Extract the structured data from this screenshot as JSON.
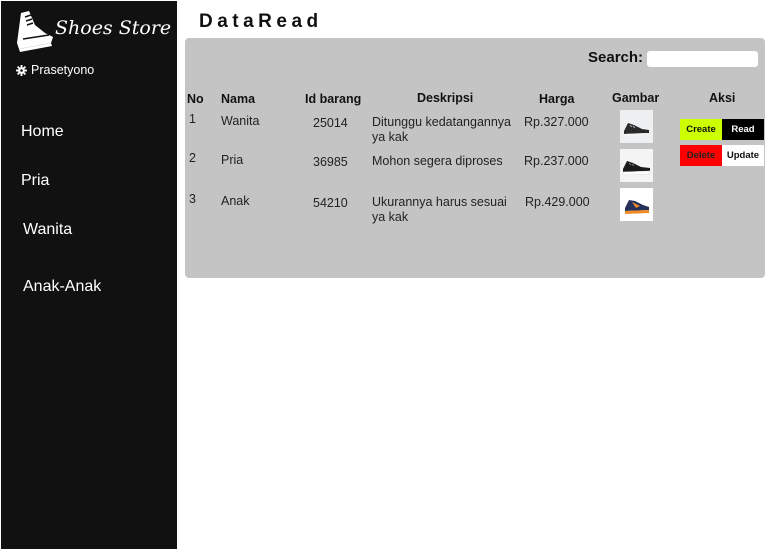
{
  "brand": {
    "name": "Shoes Store",
    "logo_icon": "shoe-icon"
  },
  "user": {
    "name": "Prasetyono",
    "icon": "gear-icon"
  },
  "nav": {
    "home": "Home",
    "pria": "Pria",
    "wanita": "Wanita",
    "anak": "Anak-Anak"
  },
  "page": {
    "title": "DataRead"
  },
  "search": {
    "label": "Search:",
    "value": ""
  },
  "table": {
    "headers": {
      "no": "No",
      "nama": "Nama",
      "id": "Id barang",
      "deskripsi": "Deskripsi",
      "harga": "Harga",
      "gambar": "Gambar",
      "aksi": "Aksi"
    },
    "rows": [
      {
        "no": "1",
        "nama": "Wanita",
        "id": "25014",
        "deskripsi": "Ditunggu kedatangannya ya kak",
        "harga": "Rp.327.000"
      },
      {
        "no": "2",
        "nama": "Pria",
        "id": "36985",
        "deskripsi": "Mohon segera diproses",
        "harga": "Rp.237.000"
      },
      {
        "no": "3",
        "nama": "Anak",
        "id": "54210",
        "deskripsi": "Ukurannya harus sesuai ya kak",
        "harga": "Rp.429.000"
      }
    ]
  },
  "actions": {
    "create": "Create",
    "read": "Read",
    "delete": "Delete",
    "update": "Update"
  },
  "colors": {
    "sidebar": "#111111",
    "panel": "#c4c4c4",
    "create": "#ccff00",
    "read": "#000000",
    "delete": "#ff0000",
    "update": "#ffffff"
  }
}
